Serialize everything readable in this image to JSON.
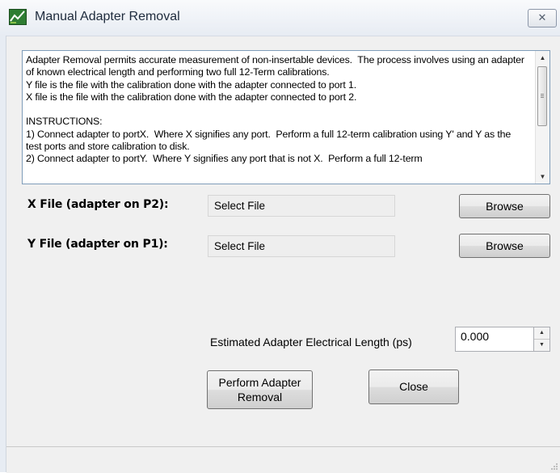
{
  "window": {
    "title": "Manual Adapter Removal",
    "close_glyph": "✕"
  },
  "description": {
    "text": "Adapter Removal permits accurate measurement of non-insertable devices.  The process involves using an adapter of known electrical length and performing two full 12-Term calibrations.\nY file is the file with the calibration done with the adapter connected to port 1.\nX file is the file with the calibration done with the adapter connected to port 2.\n\nINSTRUCTIONS:\n1) Connect adapter to portX.  Where X signifies any port.  Perform a full 12-term calibration using Y' and Y as the test ports and store calibration to disk.\n2) Connect adapter to portY.  Where Y signifies any port that is not X.  Perform a full 12-term"
  },
  "x_file": {
    "label": "X File (adapter on P2):",
    "value": "Select File",
    "browse_label": "Browse"
  },
  "y_file": {
    "label": "Y File (adapter on P1):",
    "value": "Select File",
    "browse_label": "Browse"
  },
  "electrical_length": {
    "label": "Estimated Adapter Electrical Length (ps)",
    "value": "0.000"
  },
  "buttons": {
    "perform": "Perform Adapter\nRemoval",
    "close": "Close"
  },
  "icons": [
    "app-icon",
    "close-icon",
    "scroll-up-icon",
    "scroll-down-icon",
    "spin-up-icon",
    "spin-down-icon",
    "resize-grip-icon"
  ]
}
